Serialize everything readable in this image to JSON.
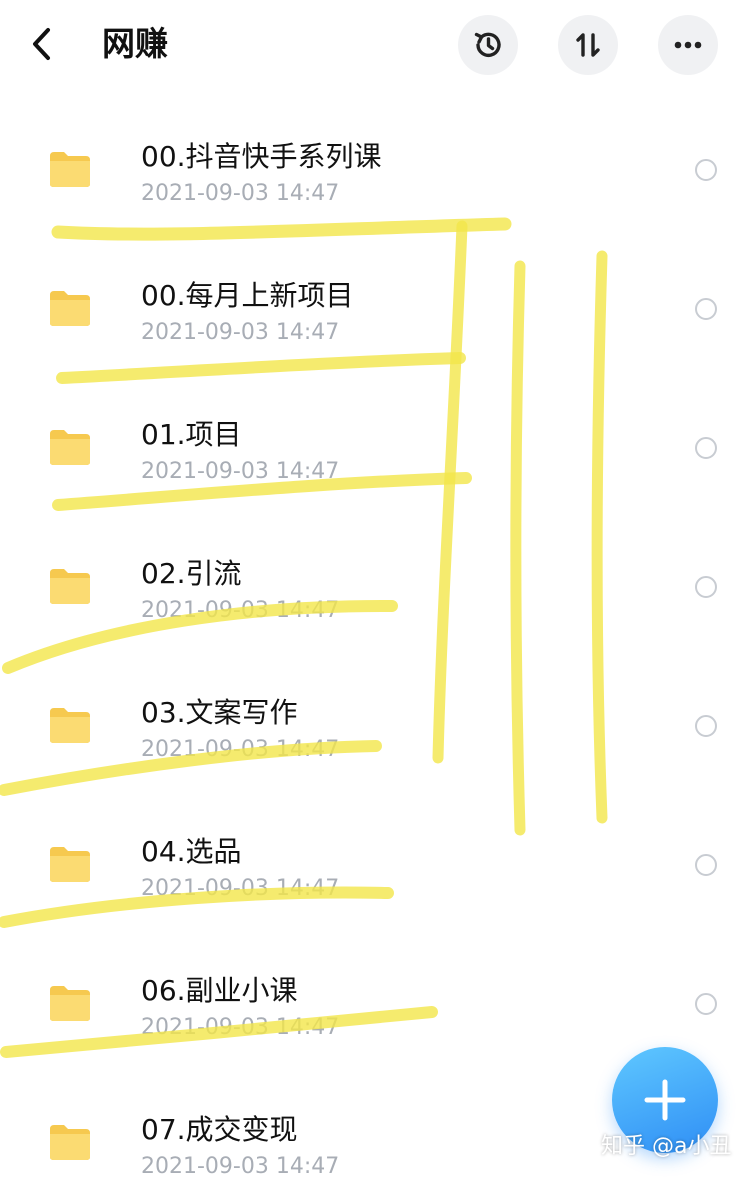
{
  "header": {
    "title": "网赚",
    "icons": [
      "back-icon",
      "history-icon",
      "sort-icon",
      "more-icon"
    ]
  },
  "files": [
    {
      "name": "00.抖音快手系列课",
      "date": "2021-09-03 14:47"
    },
    {
      "name": "00.每月上新项目",
      "date": "2021-09-03 14:47"
    },
    {
      "name": "01.项目",
      "date": "2021-09-03 14:47"
    },
    {
      "name": "02.引流",
      "date": "2021-09-03 14:47"
    },
    {
      "name": "03.文案写作",
      "date": "2021-09-03 14:47"
    },
    {
      "name": "04.选品",
      "date": "2021-09-03 14:47"
    },
    {
      "name": "06.副业小课",
      "date": "2021-09-03 14:47"
    },
    {
      "name": "07.成交变现",
      "date": "2021-09-03 14:47"
    }
  ],
  "watermark": "知乎 @a小丑",
  "colors": {
    "folder": "#f8d568",
    "highlight": "#f3e64a",
    "fab": "#3a9cf7",
    "date": "#a8adb5"
  }
}
